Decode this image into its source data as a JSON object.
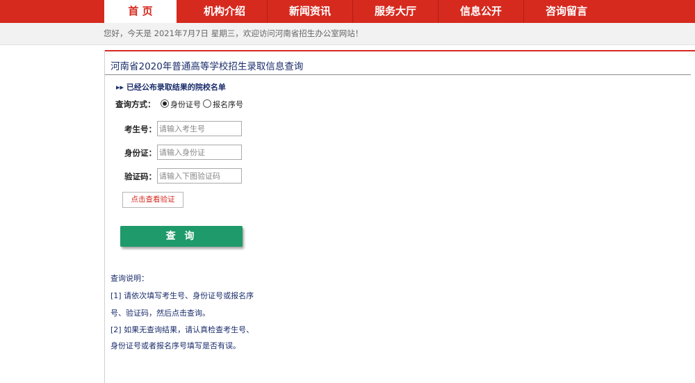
{
  "nav": {
    "items": [
      {
        "label": "首 页",
        "active": true
      },
      {
        "label": "机构介绍"
      },
      {
        "label": "新闻资讯"
      },
      {
        "label": "服务大厅"
      },
      {
        "label": "信息公开"
      },
      {
        "label": "咨询留言"
      }
    ]
  },
  "greeting": "您好，今天是 2021年7月7日 星期三，欢迎访问河南省招生办公室网站！",
  "page": {
    "title": "河南省2020年普通高等学校招生录取信息查询",
    "published_link": "▸▸ 已经公布录取结果的院校名单"
  },
  "form": {
    "mode_label": "查询方式：",
    "mode_options": [
      {
        "label": "身份证号",
        "checked": true
      },
      {
        "label": "报名序号",
        "checked": false
      }
    ],
    "fields": [
      {
        "label": "考生号：",
        "placeholder": "请输入考生号"
      },
      {
        "label": "身份证：",
        "placeholder": "请输入身份证"
      },
      {
        "label": "验证码：",
        "placeholder": "请输入下图验证码"
      }
    ],
    "captcha_button": "点击查看验证",
    "submit_button": "查 询"
  },
  "notes": {
    "title": "查询说明：",
    "lines": [
      "[1] 请依次填写考生号、身份证号或报名序",
      "号、验证码，然后点击查询。",
      "[2] 如果无查询结果，请认真检查考生号、",
      "身份证号或者报名序号填写是否有误。"
    ]
  },
  "colors": {
    "brand_red": "#d62a1f",
    "link_blue": "#1a2d6b",
    "button_green": "#1f9a6a"
  }
}
